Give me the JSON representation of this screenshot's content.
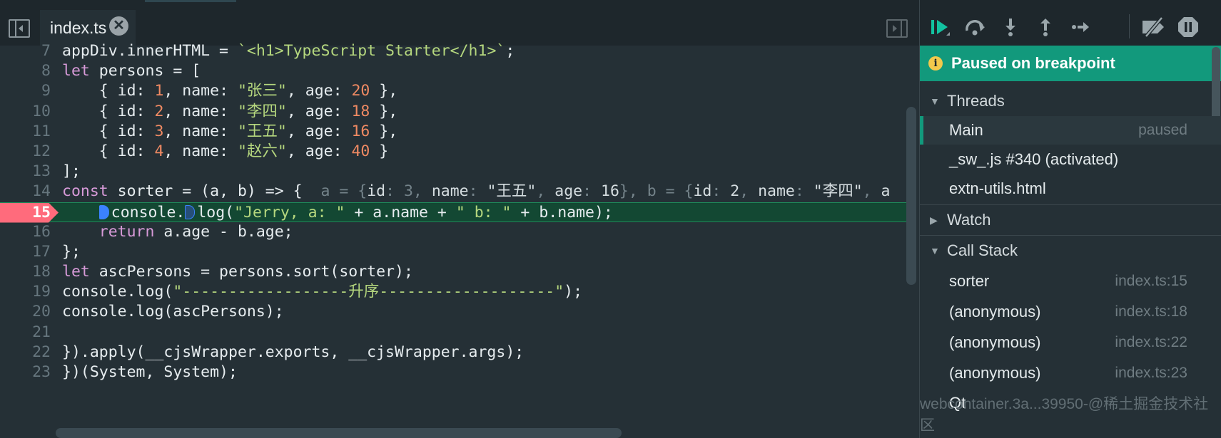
{
  "editor": {
    "tab": {
      "label": "index.ts",
      "close": "✕"
    },
    "lines": [
      {
        "n": "7",
        "parts": [
          [
            "t",
            "appDiv.innerHTML = "
          ],
          [
            "str",
            "`<h1>TypeScript Starter</h1>`"
          ],
          [
            "t",
            ";"
          ]
        ]
      },
      {
        "n": "8",
        "parts": [
          [
            "kw",
            "let"
          ],
          [
            "t",
            " persons = ["
          ]
        ]
      },
      {
        "n": "9",
        "parts": [
          [
            "t",
            "    { id: "
          ],
          [
            "num",
            "1"
          ],
          [
            "t",
            ", name: "
          ],
          [
            "str",
            "\"张三\""
          ],
          [
            "t",
            ", age: "
          ],
          [
            "num",
            "20"
          ],
          [
            "t",
            " },"
          ]
        ]
      },
      {
        "n": "10",
        "parts": [
          [
            "t",
            "    { id: "
          ],
          [
            "num",
            "2"
          ],
          [
            "t",
            ", name: "
          ],
          [
            "str",
            "\"李四\""
          ],
          [
            "t",
            ", age: "
          ],
          [
            "num",
            "18"
          ],
          [
            "t",
            " },"
          ]
        ]
      },
      {
        "n": "11",
        "parts": [
          [
            "t",
            "    { id: "
          ],
          [
            "num",
            "3"
          ],
          [
            "t",
            ", name: "
          ],
          [
            "str",
            "\"王五\""
          ],
          [
            "t",
            ", age: "
          ],
          [
            "num",
            "16"
          ],
          [
            "t",
            " },"
          ]
        ]
      },
      {
        "n": "12",
        "parts": [
          [
            "t",
            "    { id: "
          ],
          [
            "num",
            "4"
          ],
          [
            "t",
            ", name: "
          ],
          [
            "str",
            "\"赵六\""
          ],
          [
            "t",
            ", age: "
          ],
          [
            "num",
            "40"
          ],
          [
            "t",
            " }"
          ]
        ]
      },
      {
        "n": "13",
        "parts": [
          [
            "t",
            "];"
          ]
        ]
      },
      {
        "n": "14",
        "parts": [
          [
            "kw",
            "const"
          ],
          [
            "t",
            " sorter = (a, b) => {  "
          ],
          [
            "hint",
            "a = {"
          ],
          [
            "hintv",
            "id"
          ],
          [
            "hint",
            ": "
          ],
          [
            "hint",
            "3"
          ],
          [
            "hint",
            ", "
          ],
          [
            "hintv",
            "name"
          ],
          [
            "hint",
            ": "
          ],
          [
            "hintv",
            "\"王五\""
          ],
          [
            "hint",
            ", "
          ],
          [
            "hintv",
            "age"
          ],
          [
            "hint",
            ": "
          ],
          [
            "hintv",
            "16"
          ],
          [
            "hint",
            "}, b = {"
          ],
          [
            "hintv",
            "id"
          ],
          [
            "hint",
            ": "
          ],
          [
            "hintv",
            "2"
          ],
          [
            "hint",
            ", "
          ],
          [
            "hintv",
            "name"
          ],
          [
            "hint",
            ": "
          ],
          [
            "hintv",
            "\"李四\""
          ],
          [
            "hint",
            ", "
          ],
          [
            "hintv",
            "a"
          ]
        ]
      },
      {
        "n": "15",
        "current": true,
        "parts": [
          [
            "t",
            "    "
          ],
          [
            "stop",
            ""
          ],
          [
            "t",
            "console."
          ],
          [
            "stop2",
            ""
          ],
          [
            "t",
            "log("
          ],
          [
            "str",
            "\"Jerry, a: \""
          ],
          [
            "t",
            " + a.name + "
          ],
          [
            "str",
            "\" b: \""
          ],
          [
            "t",
            " + b.name);"
          ]
        ]
      },
      {
        "n": "16",
        "parts": [
          [
            "t",
            "    "
          ],
          [
            "kw",
            "return"
          ],
          [
            "t",
            " a.age - b.age;"
          ]
        ]
      },
      {
        "n": "17",
        "parts": [
          [
            "t",
            "};"
          ]
        ]
      },
      {
        "n": "18",
        "parts": [
          [
            "kw",
            "let"
          ],
          [
            "t",
            " ascPersons = persons.sort(sorter);"
          ]
        ]
      },
      {
        "n": "19",
        "parts": [
          [
            "t",
            "console.log("
          ],
          [
            "str",
            "\"------------------升序-------------------\""
          ],
          [
            "t",
            ");"
          ]
        ]
      },
      {
        "n": "20",
        "parts": [
          [
            "t",
            "console.log(ascPersons);"
          ]
        ]
      },
      {
        "n": "21",
        "parts": []
      },
      {
        "n": "22",
        "parts": [
          [
            "t",
            "}).apply(__cjsWrapper.exports, __cjsWrapper.args);"
          ]
        ]
      },
      {
        "n": "23",
        "parts": [
          [
            "t",
            "})(System, System);"
          ]
        ]
      }
    ]
  },
  "debug": {
    "toolbar": [
      "continue-icon",
      "step-over-icon",
      "step-into-icon",
      "step-out-icon",
      "step-icon",
      "deactivate-breakpoints-icon",
      "pause-on-exceptions-icon"
    ],
    "banner": {
      "icon": "i",
      "text": "Paused on breakpoint"
    },
    "threads": {
      "label": "Threads",
      "items": [
        {
          "name": "Main",
          "status": "paused",
          "selected": true
        },
        {
          "name": "_sw_.js #340 (activated)",
          "status": ""
        },
        {
          "name": "extn-utils.html",
          "status": ""
        }
      ]
    },
    "watch": {
      "label": "Watch"
    },
    "call_stack": {
      "label": "Call Stack",
      "items": [
        {
          "name": "sorter",
          "loc": "index.ts:15"
        },
        {
          "name": "(anonymous)",
          "loc": "index.ts:18"
        },
        {
          "name": "(anonymous)",
          "loc": "index.ts:22"
        },
        {
          "name": "(anonymous)",
          "loc": "index.ts:23"
        },
        {
          "name": "Qt",
          "loc": ""
        }
      ]
    },
    "watermark": "webcontainer.3a...39950-@稀土掘金技术社区"
  },
  "colors": {
    "accent": "#12997c",
    "breakpoint": "#ff6b7c",
    "current_line": "#134833",
    "background": "#253036"
  }
}
